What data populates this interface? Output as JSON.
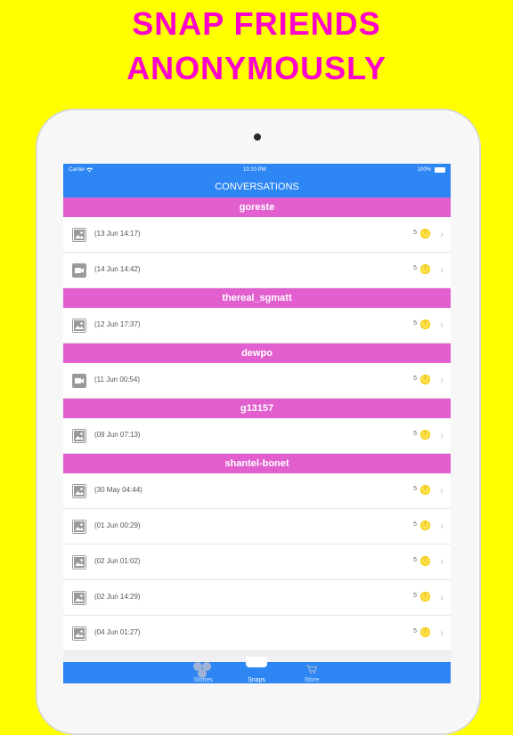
{
  "headline": {
    "line1": "SNAP FRIENDS",
    "line2": "ANONYMOUSLY"
  },
  "status_bar": {
    "carrier": "Carrier",
    "time": "10:10 PM",
    "battery": "100%"
  },
  "nav": {
    "title": "CONVERSATIONS"
  },
  "conversations": [
    {
      "user": "goreste",
      "items": [
        {
          "type": "photo",
          "date": "(13 Jun 14:17)",
          "count": "5"
        },
        {
          "type": "video",
          "date": "(14 Jun 14:42)",
          "count": "5"
        }
      ]
    },
    {
      "user": "thereal_sgmatt",
      "items": [
        {
          "type": "photo",
          "date": "(12 Jun 17:37)",
          "count": "5"
        }
      ]
    },
    {
      "user": "dewpo",
      "items": [
        {
          "type": "video",
          "date": "(11 Jun 00:54)",
          "count": "5"
        }
      ]
    },
    {
      "user": "g13157",
      "items": [
        {
          "type": "photo",
          "date": "(09 Jun 07:13)",
          "count": "5"
        }
      ]
    },
    {
      "user": "shantel-bonet",
      "items": [
        {
          "type": "photo",
          "date": "(30 May 04:44)",
          "count": "5"
        },
        {
          "type": "photo",
          "date": "(01 Jun 00:29)",
          "count": "5"
        },
        {
          "type": "photo",
          "date": "(02 Jun 01:02)",
          "count": "5"
        },
        {
          "type": "photo",
          "date": "(02 Jun 14:29)",
          "count": "5"
        },
        {
          "type": "photo",
          "date": "(04 Jun 01:27)",
          "count": "5"
        }
      ]
    }
  ],
  "tabbar": {
    "tabs": [
      {
        "label": "Stories",
        "icon": "stories-icon"
      },
      {
        "label": "Snaps",
        "icon": "snaps-icon"
      },
      {
        "label": "Store",
        "icon": "cart-icon"
      }
    ]
  },
  "colors": {
    "background": "#ffff00",
    "headline": "#ff00cc",
    "section": "#e15fcf",
    "bar": "#2d86f4"
  }
}
